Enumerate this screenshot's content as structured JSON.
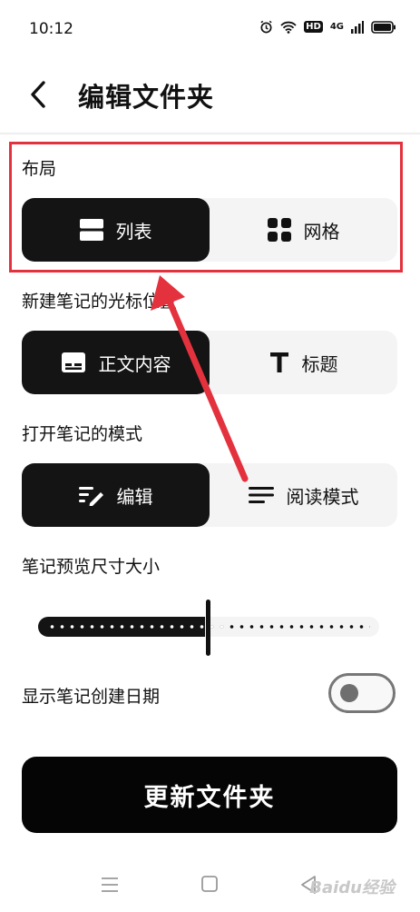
{
  "status_bar": {
    "time": "10:12",
    "hd": "HD",
    "net": "4G"
  },
  "header": {
    "title": "编辑文件夹"
  },
  "layout": {
    "label": "布局",
    "options": [
      "列表",
      "网格"
    ],
    "selected": 0
  },
  "cursor": {
    "label": "新建笔记的光标位置",
    "options": [
      "正文内容",
      "标题"
    ],
    "selected": 0
  },
  "open_mode": {
    "label": "打开笔记的模式",
    "options": [
      "编辑",
      "阅读模式"
    ],
    "selected": 0
  },
  "preview_size": {
    "label": "笔记预览尺寸大小",
    "value": 0.49
  },
  "show_date": {
    "label": "显示笔记创建日期",
    "on": false
  },
  "update_button": "更新文件夹",
  "watermark": "Baidu经验",
  "colors": {
    "accent_dark": "#141414",
    "annotation": "#e3323e"
  },
  "icons": [
    "back-arrow-icon",
    "list-icon",
    "grid-icon",
    "text-block-icon",
    "title-t-icon",
    "edit-lines-icon",
    "reading-lines-icon",
    "menu-icon",
    "home-square-icon",
    "back-triangle-icon"
  ]
}
